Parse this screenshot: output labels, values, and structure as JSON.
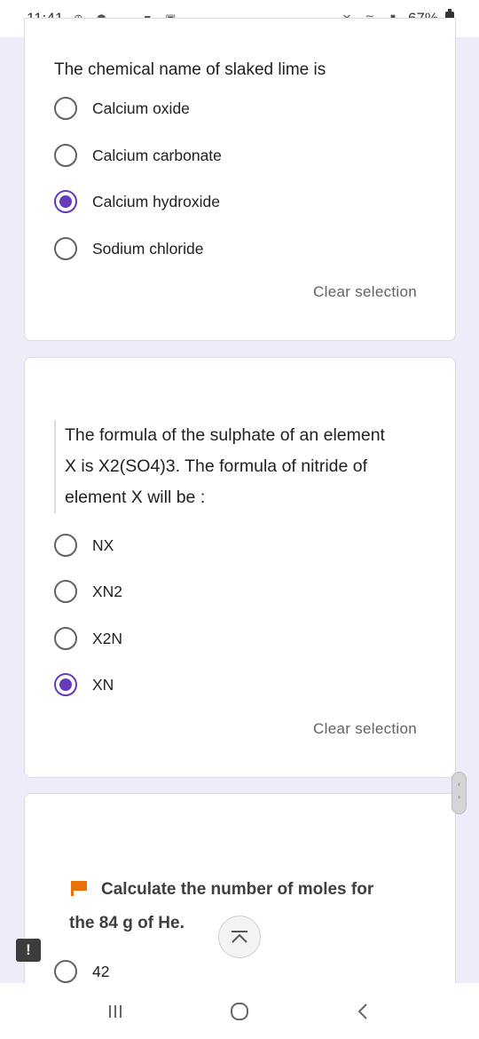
{
  "status_bar": {
    "time": "11:41",
    "battery": "67%",
    "icons_left": [
      "plus-circle-icon",
      "weather-icon",
      "cloud-icon",
      "video-icon",
      "image-icon"
    ],
    "icons_right": [
      "mute-icon",
      "wifi-icon",
      "signal-icon",
      "battery-icon"
    ]
  },
  "questions": [
    {
      "title": "The chemical name of slaked lime is",
      "options": [
        "Calcium oxide",
        "Calcium carbonate",
        "Calcium hydroxide",
        "Sodium chloride"
      ],
      "selected_index": 2,
      "clear_label": "Clear selection"
    },
    {
      "title_lines": [
        "The formula of the sulphate of an element",
        "X is X2(SO4)3. The formula of nitride of",
        "element X will be :"
      ],
      "options": [
        "NX",
        "XN2",
        "X2N",
        "XN"
      ],
      "selected_index": 3,
      "clear_label": "Clear selection"
    },
    {
      "title_line1": "Calculate the number of moles for",
      "title_line2": "the 84 g of He.",
      "options": [
        "42"
      ],
      "selected_index": -1
    }
  ],
  "colors": {
    "accent": "#673ab7",
    "background": "#f0ebf8",
    "flag": "#e8710a"
  }
}
